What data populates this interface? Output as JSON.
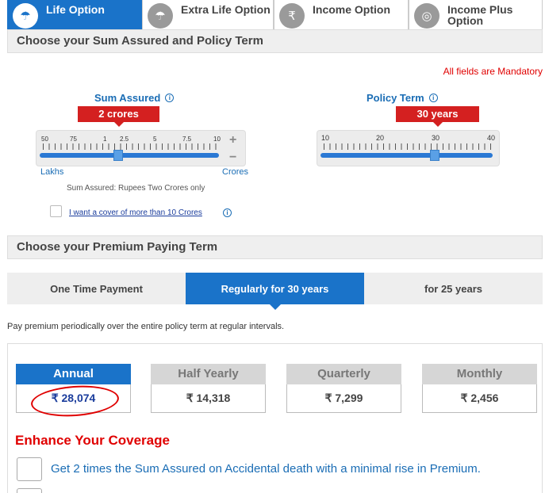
{
  "tabs": [
    {
      "label": "Life Option",
      "icon": "umbrella-person-icon",
      "active": true
    },
    {
      "label": "Extra Life Option",
      "icon": "umbrella-icon",
      "active": false
    },
    {
      "label": "Income Option",
      "icon": "rupee-bag-icon",
      "active": false
    },
    {
      "label": "Income Plus Option",
      "icon": "coins-bag-icon",
      "active": false
    }
  ],
  "sum_policy": {
    "heading": "Choose your Sum Assured and Policy Term",
    "mandatory": "All fields are Mandatory"
  },
  "sum_assured": {
    "title": "Sum Assured",
    "value_flag": "2 crores",
    "scale": [
      "50",
      "75",
      "1",
      "2.5",
      "5",
      "7.5",
      "10"
    ],
    "min_label": "Lakhs",
    "max_label": "Crores",
    "plus": "+",
    "minus": "−",
    "caption": "Sum Assured: Rupees Two Crores only",
    "more_cover_link": "I want a cover of more than 10 Crores"
  },
  "policy_term": {
    "title": "Policy Term",
    "value_flag": "30 years",
    "scale": [
      "10",
      "20",
      "30",
      "40"
    ]
  },
  "premium_term": {
    "heading": "Choose your Premium Paying Term",
    "options": [
      "One Time Payment",
      "Regularly for 30 years",
      "for 25 years"
    ],
    "description": "Pay premium periodically over the entire policy term at regular intervals."
  },
  "frequencies": [
    {
      "label": "Annual",
      "amount": "₹ 28,074"
    },
    {
      "label": "Half Yearly",
      "amount": "₹ 14,318"
    },
    {
      "label": "Quarterly",
      "amount": "₹ 7,299"
    },
    {
      "label": "Monthly",
      "amount": "₹ 2,456"
    }
  ],
  "enhance": {
    "heading": "Enhance Your Coverage",
    "rider": "Get 2 times the Sum Assured on Accidental death with a minimal rise in Premium."
  },
  "colors": {
    "accent": "#1a73c9",
    "flag": "#d42020",
    "mandatory": "#e00000"
  }
}
